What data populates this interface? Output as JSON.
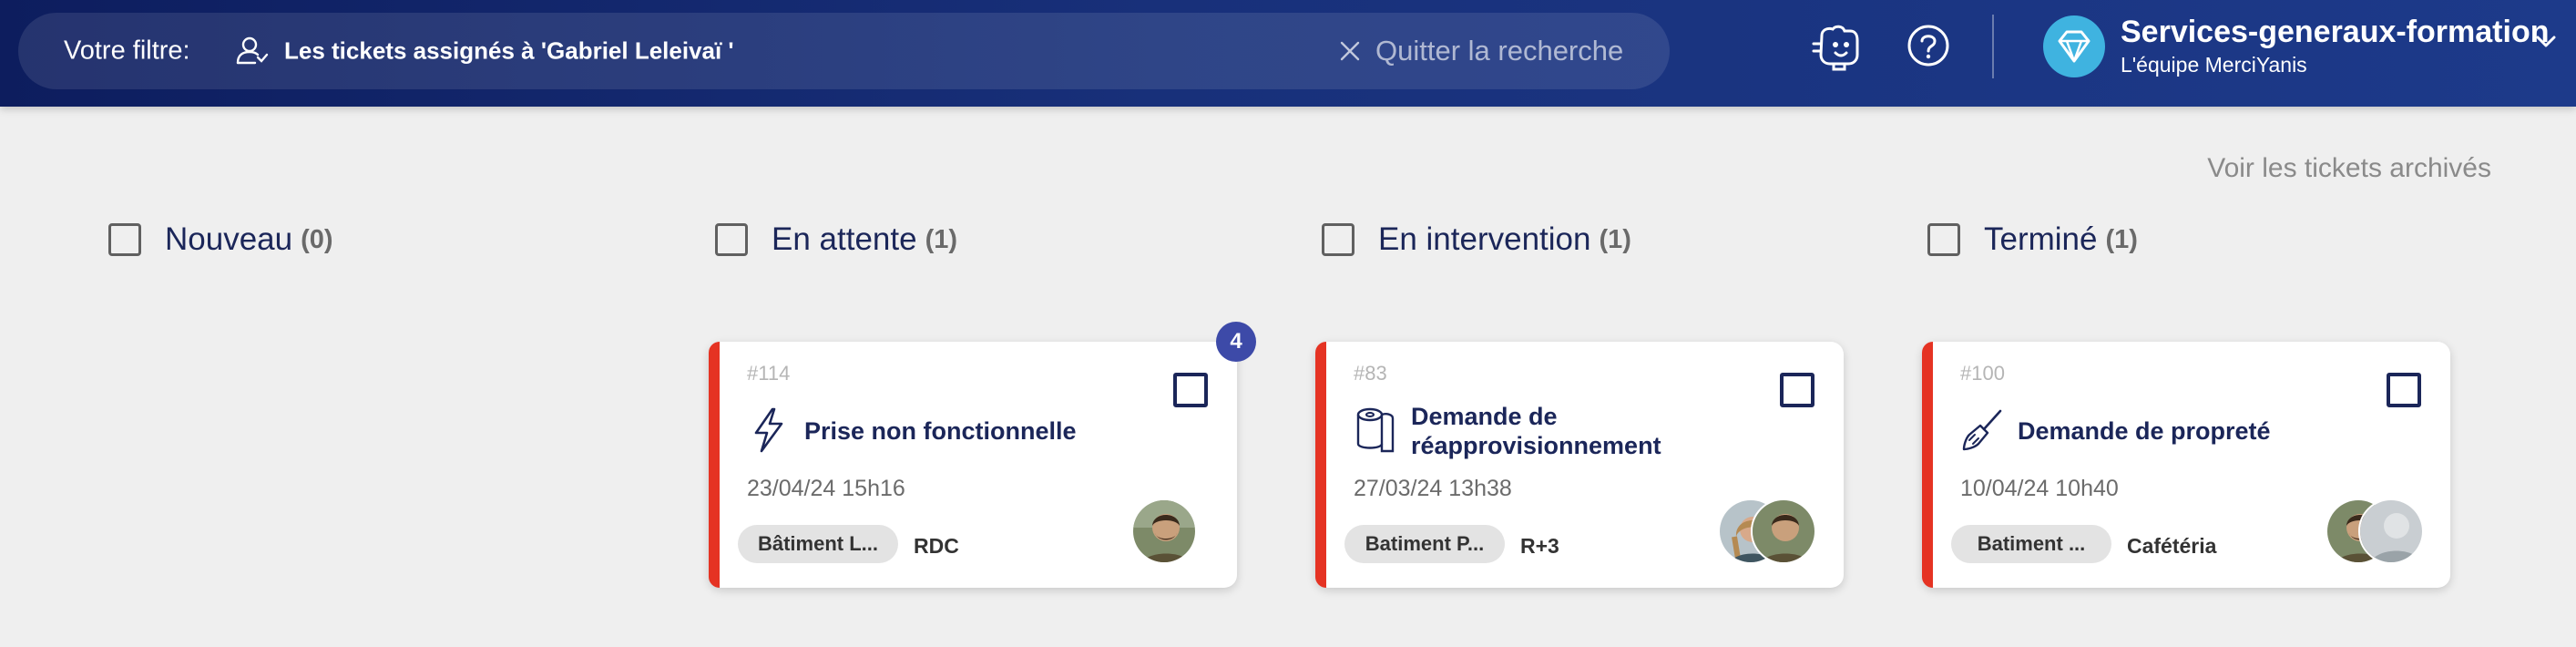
{
  "header": {
    "filter_label": "Votre filtre:",
    "filter_value": "Les tickets assignés à 'Gabriel Leleivaï '",
    "quit_search_label": "Quitter la recherche",
    "org_name": "Services-generaux-formation",
    "org_team": "L'équipe MerciYanis"
  },
  "archived_link": "Voir les tickets archivés",
  "columns": [
    {
      "title": "Nouveau",
      "count": "(0)"
    },
    {
      "title": "En attente",
      "count": "(1)"
    },
    {
      "title": "En intervention",
      "count": "(1)"
    },
    {
      "title": "Terminé",
      "count": "(1)"
    }
  ],
  "cards": [
    {
      "number": "#114",
      "title_line1": "Prise non fonctionnelle",
      "title_line2": "",
      "icon": "lightning-icon",
      "date": "23/04/24 15h16",
      "building": "Bâtiment L...",
      "floor": "RDC",
      "badge": "4"
    },
    {
      "number": "#83",
      "title_line1": "Demande de",
      "title_line2": "réapprovisionnement",
      "icon": "toilet-paper-icon",
      "date": "27/03/24 13h38",
      "building": "Batiment P...",
      "floor": "R+3"
    },
    {
      "number": "#100",
      "title_line1": "Demande de propreté",
      "title_line2": "",
      "icon": "broom-icon",
      "date": "10/04/24 10h40",
      "building": "Batiment ...",
      "floor": "Cafétéria"
    }
  ],
  "colors": {
    "accent_red": "#e53323",
    "navy_text": "#1b2659",
    "badge_blue": "#3d4aa8",
    "header_gradient_start": "#0d1d5e",
    "header_gradient_end": "#1d3a8a",
    "org_avatar": "#3fb3e0"
  }
}
